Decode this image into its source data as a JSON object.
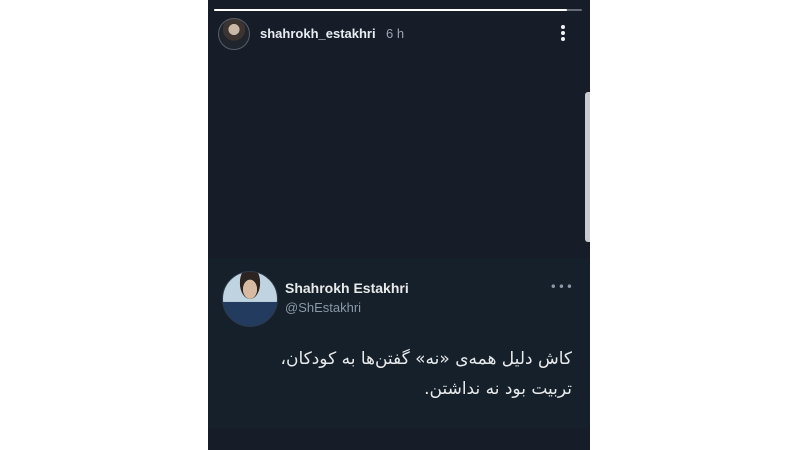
{
  "story": {
    "username": "shahrokh_estakhri",
    "time": "6 h",
    "progress_fraction": 0.96,
    "more_icon": "vertical-ellipsis-icon"
  },
  "tweet": {
    "name": "Shahrokh Estakhri",
    "handle": "@ShEstakhri",
    "more_label": "•••",
    "line1": "کاش دلیل همه‌ی «نه» گفتن‌ها به کودکان،",
    "line2": "تربیت بود نه نداشتن."
  },
  "colors": {
    "background": "#161d29",
    "card": "#15202b",
    "text": "#e7e9ea",
    "muted": "#8b98a5"
  }
}
